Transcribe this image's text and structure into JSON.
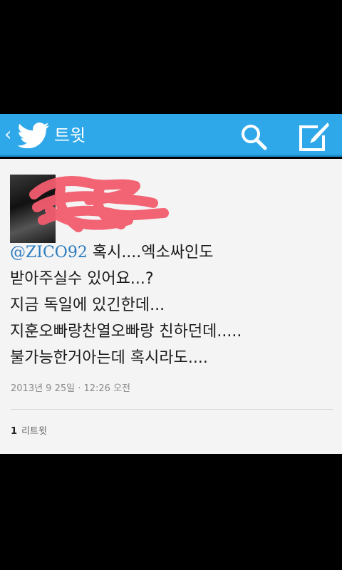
{
  "header": {
    "back_glyph": "‹",
    "title": "트윗",
    "icons": [
      "twitter-bird-icon",
      "search-icon",
      "compose-icon"
    ],
    "color": "#2fa8ea"
  },
  "tweet": {
    "mention": "@ZICO92",
    "lines": [
      " 혹시....엑소싸인도",
      "받아주실수 있어요...?",
      "지금 독일에 있긴한데...",
      "지훈오빠랑찬열오빠랑 친하던데.....",
      "불가능한거아는데 혹시라도...."
    ],
    "timestamp": "2013년 9 25일 · 12:26 오전",
    "retweet_count": "1",
    "retweet_label": "리트윗"
  },
  "colors": {
    "mention": "#2b7bbf",
    "scribble": "#f25c6e"
  }
}
